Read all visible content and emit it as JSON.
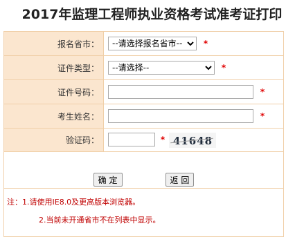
{
  "title": "2017年监理工程师执业资格考试准考证打印",
  "fields": [
    {
      "label": "报名省市：",
      "type": "select",
      "value": "--请选择报名省市--",
      "required": "*"
    },
    {
      "label": "证件类型：",
      "type": "select",
      "value": "--请选择--",
      "required": "*"
    },
    {
      "label": "证件号码：",
      "type": "input",
      "value": "",
      "required": "*"
    },
    {
      "label": "考生姓名：",
      "type": "input",
      "value": "",
      "required": "*"
    },
    {
      "label": "验证码：",
      "type": "input",
      "value": "",
      "required": "*",
      "captcha_text": "41648"
    }
  ],
  "buttons": {
    "confirm": "确 定",
    "back": "返 回"
  },
  "notes": [
    "注：1.请使用IE8.0及更高版本浏览器。",
    "2.当前未开通省市不在列表中显示。"
  ],
  "colors": {
    "label_bg": "#fbe6cf",
    "border": "#f0cfa8",
    "required": "#e00000",
    "note": "#c00000"
  }
}
